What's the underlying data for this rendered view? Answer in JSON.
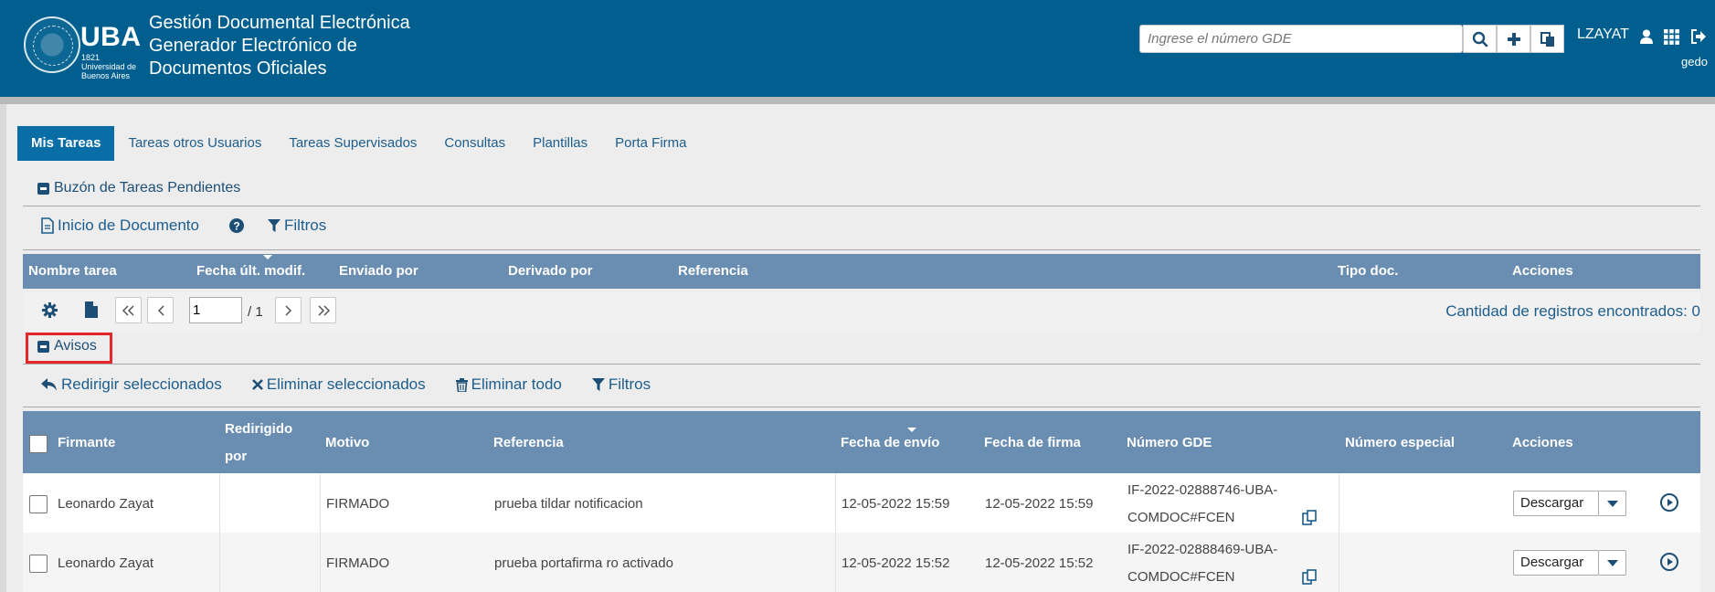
{
  "header": {
    "logo_name": "UBA",
    "logo_sub": "1821 Universidad de Buenos Aires",
    "title_line1": "Gestión Documental Electrónica",
    "title_line2": "Generador Electrónico de",
    "title_line3": "Documentos Oficiales",
    "search_placeholder": "Ingrese el número GDE",
    "user": "LZAYAT",
    "module": "gedo",
    "icons": [
      "search-icon",
      "plus-icon",
      "copy-icon",
      "user-icon",
      "apps-grid-icon",
      "logout-icon"
    ]
  },
  "tabs": [
    {
      "label": "Mis Tareas",
      "active": true
    },
    {
      "label": "Tareas otros Usuarios",
      "active": false
    },
    {
      "label": "Tareas Supervisados",
      "active": false
    },
    {
      "label": "Consultas",
      "active": false
    },
    {
      "label": "Plantillas",
      "active": false
    },
    {
      "label": "Porta Firma",
      "active": false
    }
  ],
  "pendientes": {
    "title": "Buzón de Tareas Pendientes",
    "toolbar": {
      "inicio": "Inicio de Documento",
      "filtros": "Filtros"
    },
    "columns": [
      "Nombre tarea",
      "Fecha últ. modif.",
      "Enviado por",
      "Derivado por",
      "Referencia",
      "Tipo doc.",
      "Acciones"
    ],
    "pager": {
      "page": "1",
      "total": "/ 1",
      "count": "Cantidad de registros encontrados: 0"
    }
  },
  "avisos": {
    "title": "Avisos",
    "toolbar": {
      "redirigir": "Redirigir seleccionados",
      "eliminar_sel": "Eliminar seleccionados",
      "eliminar_todo": "Eliminar todo",
      "filtros": "Filtros"
    },
    "columns": {
      "firmante": "Firmante",
      "redirigido_1": "Redirigido",
      "redirigido_2": "por",
      "motivo": "Motivo",
      "referencia": "Referencia",
      "fecha_envio": "Fecha de envío",
      "fecha_firma": "Fecha de firma",
      "numero_gde": "Número GDE",
      "numero_especial": "Número especial",
      "acciones": "Acciones"
    },
    "rows": [
      {
        "firmante": "Leonardo Zayat",
        "redirigido": "",
        "motivo": "FIRMADO",
        "referencia": "prueba tildar notificacion",
        "fecha_envio": "12-05-2022 15:59",
        "fecha_firma": "12-05-2022 15:59",
        "gde_1": "IF-2022-02888746-UBA-",
        "gde_2": "COMDOC#FCEN",
        "numero_especial": "",
        "accion": "Descargar"
      },
      {
        "firmante": "Leonardo Zayat",
        "redirigido": "",
        "motivo": "FIRMADO",
        "referencia": "prueba portafirma ro activado",
        "fecha_envio": "12-05-2022 15:52",
        "fecha_firma": "12-05-2022 15:52",
        "gde_1": "IF-2022-02888469-UBA-",
        "gde_2": "COMDOC#FCEN",
        "numero_especial": "",
        "accion": "Descargar"
      }
    ]
  },
  "colors": {
    "header_bg": "#005f8f",
    "tab_active": "#0a6ea6",
    "table_header": "#6a8db2",
    "link": "#1d5d8c",
    "highlight": "#e5262a"
  }
}
